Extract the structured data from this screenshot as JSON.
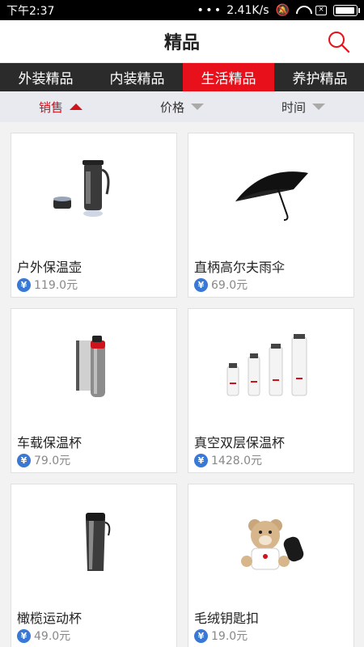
{
  "status_bar": {
    "time": "下午2:37",
    "speed": "2.41K/s",
    "box_glyph": "×"
  },
  "header": {
    "title": "精品",
    "search_icon": "search-icon",
    "accent": "#e8101a"
  },
  "tabs": [
    {
      "label": "外装精品",
      "active": false
    },
    {
      "label": "内装精品",
      "active": false
    },
    {
      "label": "生活精品",
      "active": true
    },
    {
      "label": "养护精品",
      "active": false
    }
  ],
  "sort": [
    {
      "label": "销售",
      "active": true,
      "direction": "up"
    },
    {
      "label": "价格",
      "active": false,
      "direction": "down"
    },
    {
      "label": "时间",
      "active": false,
      "direction": "down"
    }
  ],
  "products": [
    {
      "name": "户外保温壶",
      "currency": "¥",
      "price": "119.0元",
      "image": "thermos-kettle"
    },
    {
      "name": "直柄高尔夫雨伞",
      "currency": "¥",
      "price": "69.0元",
      "image": "golf-umbrella"
    },
    {
      "name": "车载保温杯",
      "currency": "¥",
      "price": "79.0元",
      "image": "car-thermos-cup"
    },
    {
      "name": "真空双层保温杯",
      "currency": "¥",
      "price": "1428.0元",
      "image": "vacuum-bottles"
    },
    {
      "name": "橄榄运动杯",
      "currency": "¥",
      "price": "49.0元",
      "image": "olive-sport-cup"
    },
    {
      "name": "毛绒钥匙扣",
      "currency": "¥",
      "price": "19.0元",
      "image": "plush-keychain"
    }
  ]
}
